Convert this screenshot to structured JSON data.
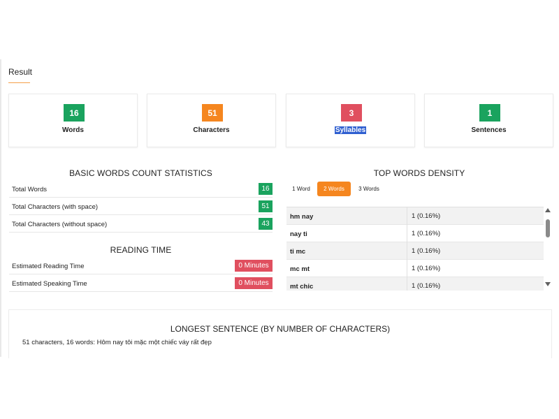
{
  "result": {
    "title": "Result"
  },
  "stats": [
    {
      "value": "16",
      "label": "Words",
      "color": "#1aa35e"
    },
    {
      "value": "51",
      "label": "Characters",
      "color": "#f5861f"
    },
    {
      "value": "3",
      "label": "Syllables",
      "color": "#e04f5f"
    },
    {
      "value": "1",
      "label": "Sentences",
      "color": "#1aa35e"
    }
  ],
  "basic_stats": {
    "title": "BASIC WORDS COUNT STATISTICS",
    "rows": [
      {
        "label": "Total Words",
        "value": "16"
      },
      {
        "label": "Total Characters (with space)",
        "value": "51"
      },
      {
        "label": "Total Characters (without space)",
        "value": "43"
      }
    ]
  },
  "reading_time": {
    "title": "READING TIME",
    "rows": [
      {
        "label": "Estimated Reading Time",
        "value": "0 Minutes"
      },
      {
        "label": "Estimated Speaking Time",
        "value": "0 Minutes"
      }
    ]
  },
  "density": {
    "title": "TOP WORDS DENSITY",
    "tabs": [
      "1 Word",
      "2 Words",
      "3 Words"
    ],
    "active_tab": "2 Words",
    "rows": [
      {
        "words": "hm nay",
        "count": "1 (0.16%)"
      },
      {
        "words": "nay ti",
        "count": "1 (0.16%)"
      },
      {
        "words": "ti mc",
        "count": "1 (0.16%)"
      },
      {
        "words": "mc mt",
        "count": "1 (0.16%)"
      },
      {
        "words": "mt chic",
        "count": "1 (0.16%)"
      }
    ]
  },
  "longest_sentence": {
    "title": "LONGEST SENTENCE (BY NUMBER OF CHARACTERS)",
    "text": "51 characters, 16 words: Hôm nay tôi mặc một chiếc váy rất đẹp"
  },
  "colors": {
    "green": "#1aa35e",
    "orange": "#f5861f",
    "red": "#e04f5f",
    "selection": "#2f5fd0"
  }
}
